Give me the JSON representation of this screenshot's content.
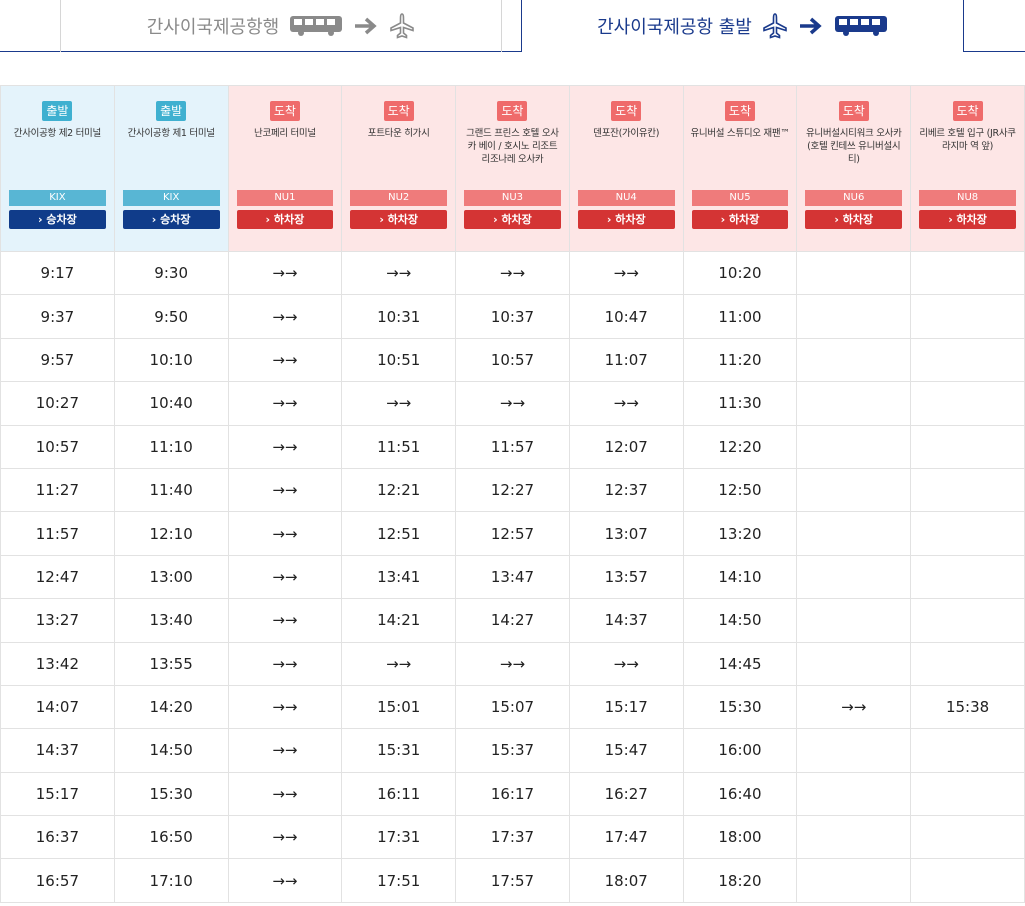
{
  "tabs": {
    "to_airport": {
      "label": "간사이국제공항행"
    },
    "from_airport": {
      "label": "간사이국제공항 출발"
    }
  },
  "colors": {
    "navy": "#1a3a8c",
    "departure_bg": "#e4f3fb",
    "arrival_bg": "#fde6e6",
    "departure_accent": "#3fb0d0",
    "arrival_accent": "#ef6b6b"
  },
  "columns": [
    {
      "type": "dep",
      "badge": "출발",
      "name": "간사이공항 제2 터미널",
      "code": "KIX",
      "action": "› 승차장"
    },
    {
      "type": "dep",
      "badge": "출발",
      "name": "간사이공항 제1 터미널",
      "code": "KIX",
      "action": "› 승차장"
    },
    {
      "type": "arr",
      "badge": "도착",
      "name": "난코페리 터미널",
      "code": "NU1",
      "action": "› 하차장"
    },
    {
      "type": "arr",
      "badge": "도착",
      "name": "포트타운 히가시",
      "code": "NU2",
      "action": "› 하차장"
    },
    {
      "type": "arr",
      "badge": "도착",
      "name": "그랜드 프린스 호텔 오사카 베이 / 호시노 리조트 리조나레 오사카",
      "code": "NU3",
      "action": "› 하차장"
    },
    {
      "type": "arr",
      "badge": "도착",
      "name": "덴포잔(가이유칸)",
      "code": "NU4",
      "action": "› 하차장"
    },
    {
      "type": "arr",
      "badge": "도착",
      "name": "유니버설 스튜디오 재팬™",
      "code": "NU5",
      "action": "› 하차장"
    },
    {
      "type": "arr",
      "badge": "도착",
      "name": "유니버설시티워크 오사카(호텔 킨테쓰 유니버설시티)",
      "code": "NU6",
      "action": "› 하차장"
    },
    {
      "type": "arr",
      "badge": "도착",
      "name": "리베르 호텔 입구 (JR사쿠라지마 역 앞)",
      "code": "NU8",
      "action": "› 하차장"
    }
  ],
  "rows": [
    [
      "9:17",
      "9:30",
      "→→",
      "→→",
      "→→",
      "→→",
      "10:20",
      "",
      ""
    ],
    [
      "9:37",
      "9:50",
      "→→",
      "10:31",
      "10:37",
      "10:47",
      "11:00",
      "",
      ""
    ],
    [
      "9:57",
      "10:10",
      "→→",
      "10:51",
      "10:57",
      "11:07",
      "11:20",
      "",
      ""
    ],
    [
      "10:27",
      "10:40",
      "→→",
      "→→",
      "→→",
      "→→",
      "11:30",
      "",
      ""
    ],
    [
      "10:57",
      "11:10",
      "→→",
      "11:51",
      "11:57",
      "12:07",
      "12:20",
      "",
      ""
    ],
    [
      "11:27",
      "11:40",
      "→→",
      "12:21",
      "12:27",
      "12:37",
      "12:50",
      "",
      ""
    ],
    [
      "11:57",
      "12:10",
      "→→",
      "12:51",
      "12:57",
      "13:07",
      "13:20",
      "",
      ""
    ],
    [
      "12:47",
      "13:00",
      "→→",
      "13:41",
      "13:47",
      "13:57",
      "14:10",
      "",
      ""
    ],
    [
      "13:27",
      "13:40",
      "→→",
      "14:21",
      "14:27",
      "14:37",
      "14:50",
      "",
      ""
    ],
    [
      "13:42",
      "13:55",
      "→→",
      "→→",
      "→→",
      "→→",
      "14:45",
      "",
      ""
    ],
    [
      "14:07",
      "14:20",
      "→→",
      "15:01",
      "15:07",
      "15:17",
      "15:30",
      "→→",
      "15:38"
    ],
    [
      "14:37",
      "14:50",
      "→→",
      "15:31",
      "15:37",
      "15:47",
      "16:00",
      "",
      ""
    ],
    [
      "15:17",
      "15:30",
      "→→",
      "16:11",
      "16:17",
      "16:27",
      "16:40",
      "",
      ""
    ],
    [
      "16:37",
      "16:50",
      "→→",
      "17:31",
      "17:37",
      "17:47",
      "18:00",
      "",
      ""
    ],
    [
      "16:57",
      "17:10",
      "→→",
      "17:51",
      "17:57",
      "18:07",
      "18:20",
      "",
      ""
    ]
  ]
}
